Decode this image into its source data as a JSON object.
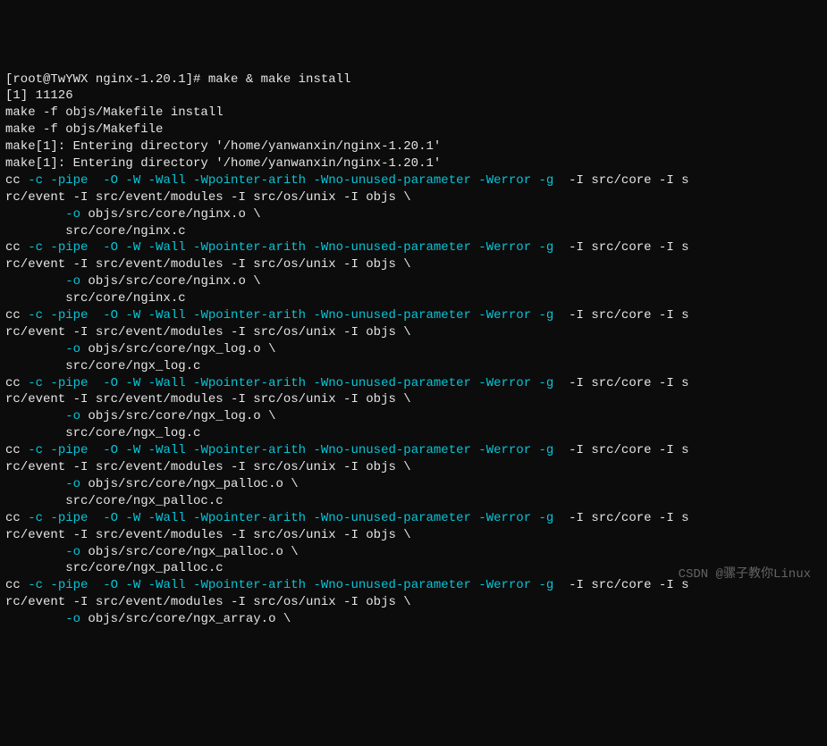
{
  "terminal": {
    "lines": [
      {
        "segments": [
          {
            "text": "[root@TwYWX nginx-1.20.1]# make & make install",
            "class": "white"
          }
        ]
      },
      {
        "segments": [
          {
            "text": "[1] 11126",
            "class": "white"
          }
        ]
      },
      {
        "segments": [
          {
            "text": "make -f objs/Makefile install",
            "class": "white"
          }
        ]
      },
      {
        "segments": [
          {
            "text": "make -f objs/Makefile",
            "class": "white"
          }
        ]
      },
      {
        "segments": [
          {
            "text": "make[1]: Entering directory '/home/yanwanxin/nginx-1.20.1'",
            "class": "white"
          }
        ]
      },
      {
        "segments": [
          {
            "text": "make[1]: Entering directory '/home/yanwanxin/nginx-1.20.1'",
            "class": "white"
          }
        ]
      },
      {
        "segments": [
          {
            "text": "cc ",
            "class": "white"
          },
          {
            "text": "-c -pipe  -O -W -Wall -Wpointer-arith -Wno-unused-parameter -Werror -g ",
            "class": "cyan"
          },
          {
            "text": " -I src/core -I s",
            "class": "white"
          }
        ]
      },
      {
        "segments": [
          {
            "text": "rc/event -I src/event/modules -I src/os/unix -I objs \\",
            "class": "white"
          }
        ]
      },
      {
        "segments": [
          {
            "text": "        ",
            "class": "white"
          },
          {
            "text": "-o",
            "class": "cyan"
          },
          {
            "text": " objs/src/core/nginx.o \\",
            "class": "white"
          }
        ]
      },
      {
        "segments": [
          {
            "text": "        src/core/nginx.c",
            "class": "white"
          }
        ]
      },
      {
        "segments": [
          {
            "text": "cc ",
            "class": "white"
          },
          {
            "text": "-c -pipe  -O -W -Wall -Wpointer-arith -Wno-unused-parameter -Werror -g ",
            "class": "cyan"
          },
          {
            "text": " -I src/core -I s",
            "class": "white"
          }
        ]
      },
      {
        "segments": [
          {
            "text": "rc/event -I src/event/modules -I src/os/unix -I objs \\",
            "class": "white"
          }
        ]
      },
      {
        "segments": [
          {
            "text": "        ",
            "class": "white"
          },
          {
            "text": "-o",
            "class": "cyan"
          },
          {
            "text": " objs/src/core/nginx.o \\",
            "class": "white"
          }
        ]
      },
      {
        "segments": [
          {
            "text": "        src/core/nginx.c",
            "class": "white"
          }
        ]
      },
      {
        "segments": [
          {
            "text": "cc ",
            "class": "white"
          },
          {
            "text": "-c -pipe  -O -W -Wall -Wpointer-arith -Wno-unused-parameter -Werror -g ",
            "class": "cyan"
          },
          {
            "text": " -I src/core -I s",
            "class": "white"
          }
        ]
      },
      {
        "segments": [
          {
            "text": "rc/event -I src/event/modules -I src/os/unix -I objs \\",
            "class": "white"
          }
        ]
      },
      {
        "segments": [
          {
            "text": "        ",
            "class": "white"
          },
          {
            "text": "-o",
            "class": "cyan"
          },
          {
            "text": " objs/src/core/ngx_log.o \\",
            "class": "white"
          }
        ]
      },
      {
        "segments": [
          {
            "text": "        src/core/ngx_log.c",
            "class": "white"
          }
        ]
      },
      {
        "segments": [
          {
            "text": "cc ",
            "class": "white"
          },
          {
            "text": "-c -pipe  -O -W -Wall -Wpointer-arith -Wno-unused-parameter -Werror -g ",
            "class": "cyan"
          },
          {
            "text": " -I src/core -I s",
            "class": "white"
          }
        ]
      },
      {
        "segments": [
          {
            "text": "rc/event -I src/event/modules -I src/os/unix -I objs \\",
            "class": "white"
          }
        ]
      },
      {
        "segments": [
          {
            "text": "        ",
            "class": "white"
          },
          {
            "text": "-o",
            "class": "cyan"
          },
          {
            "text": " objs/src/core/ngx_log.o \\",
            "class": "white"
          }
        ]
      },
      {
        "segments": [
          {
            "text": "        src/core/ngx_log.c",
            "class": "white"
          }
        ]
      },
      {
        "segments": [
          {
            "text": "cc ",
            "class": "white"
          },
          {
            "text": "-c -pipe  -O -W -Wall -Wpointer-arith -Wno-unused-parameter -Werror -g ",
            "class": "cyan"
          },
          {
            "text": " -I src/core -I s",
            "class": "white"
          }
        ]
      },
      {
        "segments": [
          {
            "text": "rc/event -I src/event/modules -I src/os/unix -I objs \\",
            "class": "white"
          }
        ]
      },
      {
        "segments": [
          {
            "text": "        ",
            "class": "white"
          },
          {
            "text": "-o",
            "class": "cyan"
          },
          {
            "text": " objs/src/core/ngx_palloc.o \\",
            "class": "white"
          }
        ]
      },
      {
        "segments": [
          {
            "text": "        src/core/ngx_palloc.c",
            "class": "white"
          }
        ]
      },
      {
        "segments": [
          {
            "text": "cc ",
            "class": "white"
          },
          {
            "text": "-c -pipe  -O -W -Wall -Wpointer-arith -Wno-unused-parameter -Werror -g ",
            "class": "cyan"
          },
          {
            "text": " -I src/core -I s",
            "class": "white"
          }
        ]
      },
      {
        "segments": [
          {
            "text": "rc/event -I src/event/modules -I src/os/unix -I objs \\",
            "class": "white"
          }
        ]
      },
      {
        "segments": [
          {
            "text": "        ",
            "class": "white"
          },
          {
            "text": "-o",
            "class": "cyan"
          },
          {
            "text": " objs/src/core/ngx_palloc.o \\",
            "class": "white"
          }
        ]
      },
      {
        "segments": [
          {
            "text": "        src/core/ngx_palloc.c",
            "class": "white"
          }
        ]
      },
      {
        "segments": [
          {
            "text": "cc ",
            "class": "white"
          },
          {
            "text": "-c -pipe  -O -W -Wall -Wpointer-arith -Wno-unused-parameter -Werror -g ",
            "class": "cyan"
          },
          {
            "text": " -I src/core -I s",
            "class": "white"
          }
        ]
      },
      {
        "segments": [
          {
            "text": "rc/event -I src/event/modules -I src/os/unix -I objs \\",
            "class": "white"
          }
        ]
      },
      {
        "segments": [
          {
            "text": "        ",
            "class": "white"
          },
          {
            "text": "-o",
            "class": "cyan"
          },
          {
            "text": " objs/src/core/ngx_array.o \\",
            "class": "white"
          }
        ]
      }
    ]
  },
  "watermark": "CSDN @骡子教你Linux"
}
